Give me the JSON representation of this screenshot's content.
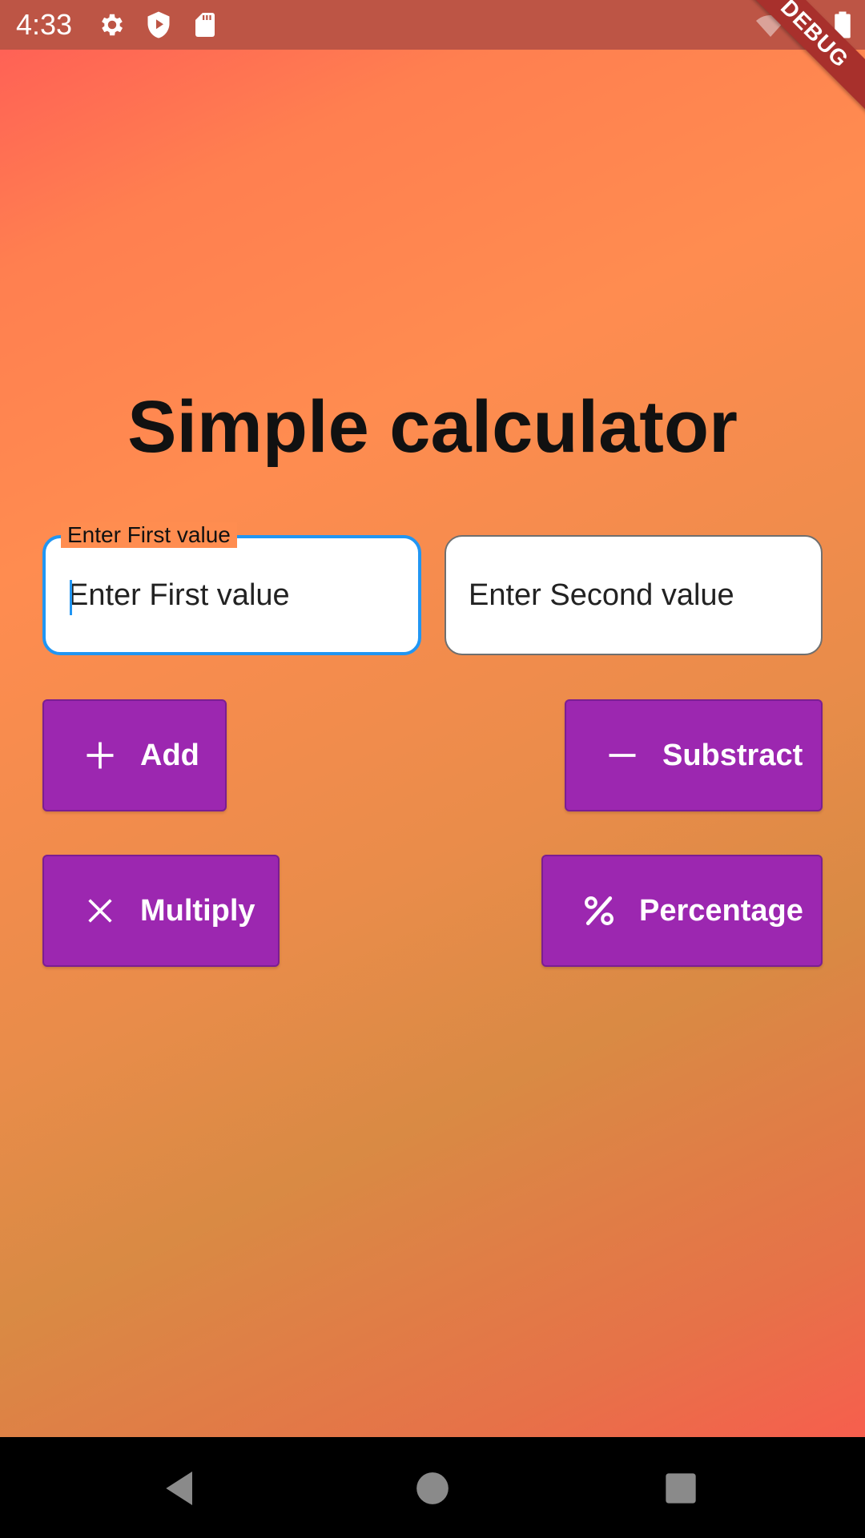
{
  "status_bar": {
    "time": "4:33",
    "icons_left": [
      "gear-icon",
      "shield-play-icon",
      "sd-card-icon"
    ],
    "icons_right": [
      "wifi-off-icon",
      "signal-lte-icon",
      "battery-icon"
    ]
  },
  "debug_banner": {
    "label": "DEBUG"
  },
  "page": {
    "title": "Simple calculator"
  },
  "inputs": {
    "first": {
      "label": "Enter First value",
      "placeholder": "Enter First value",
      "value": ""
    },
    "second": {
      "placeholder": "Enter Second value",
      "value": ""
    }
  },
  "buttons": {
    "add": {
      "label": "Add",
      "icon": "plus-icon"
    },
    "subtract": {
      "label": "Substract",
      "icon": "minus-icon"
    },
    "multiply": {
      "label": "Multiply",
      "icon": "close-x-icon"
    },
    "percentage": {
      "label": "Percentage",
      "icon": "percent-icon"
    }
  },
  "nav_bar": {
    "buttons": [
      "back-icon",
      "home-icon",
      "recents-icon"
    ]
  },
  "colors": {
    "button_bg": "#9c27b0",
    "focus_border": "#2196f3",
    "status_bar_bg": "#bd5545",
    "gradient_start": "#ff5b57",
    "gradient_mid": "#e98c4a",
    "gradient_end": "#ff5450"
  }
}
